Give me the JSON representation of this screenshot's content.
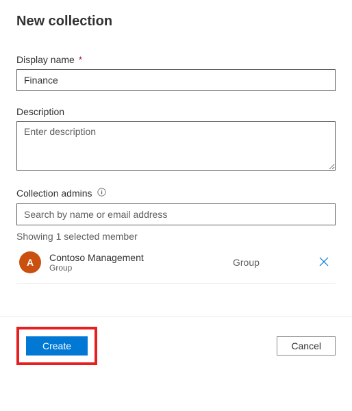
{
  "header": {
    "title": "New collection"
  },
  "form": {
    "display_name": {
      "label": "Display name",
      "required_marker": "*",
      "value": "Finance"
    },
    "description": {
      "label": "Description",
      "placeholder": "Enter description",
      "value": ""
    },
    "collection_admins": {
      "label": "Collection admins",
      "search_placeholder": "Search by name or email address",
      "search_value": "",
      "status": "Showing 1 selected member",
      "members": [
        {
          "avatar_initial": "A",
          "name": "Contoso Management",
          "subtext": "Group",
          "type": "Group"
        }
      ]
    }
  },
  "footer": {
    "create_label": "Create",
    "cancel_label": "Cancel"
  },
  "colors": {
    "primary": "#0078d4",
    "avatar": "#ca5010",
    "highlight": "#e62020",
    "close_icon": "#0078d4"
  }
}
